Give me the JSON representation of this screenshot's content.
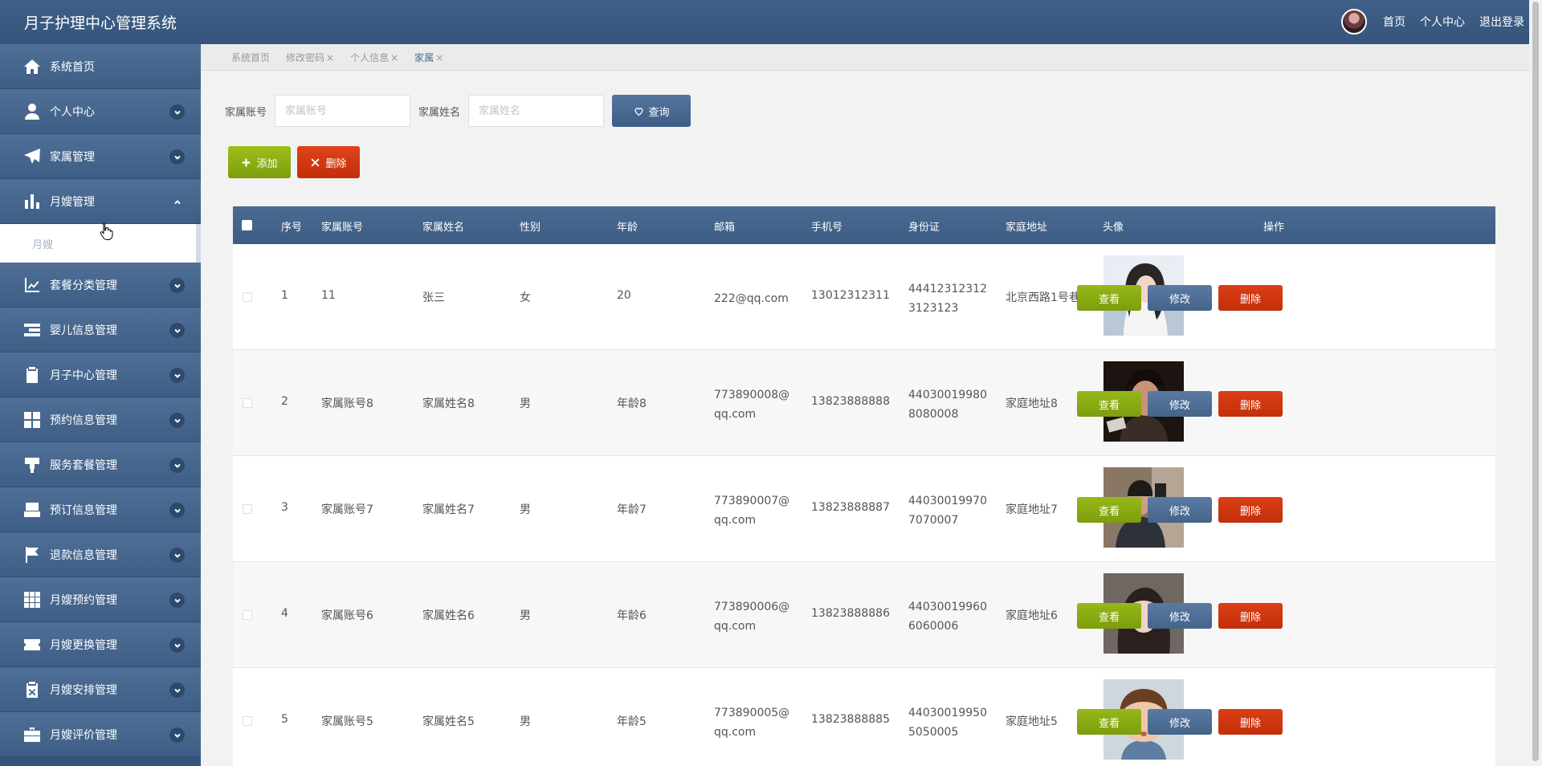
{
  "header": {
    "title": "月子护理中心管理系统",
    "links": [
      "首页",
      "个人中心",
      "退出登录"
    ]
  },
  "sidebar": {
    "items": [
      {
        "label": "系统首页",
        "icon": "home-icon"
      },
      {
        "label": "个人中心",
        "icon": "user-icon"
      },
      {
        "label": "家属管理",
        "icon": "paper-plane-icon"
      },
      {
        "label": "月嫂管理",
        "icon": "bar-chart-icon"
      },
      {
        "label": "套餐分类管理",
        "icon": "line-chart-icon"
      },
      {
        "label": "婴儿信息管理",
        "icon": "list-icon"
      },
      {
        "label": "月子中心管理",
        "icon": "clipboard-icon"
      },
      {
        "label": "预约信息管理",
        "icon": "grid-icon"
      },
      {
        "label": "服务套餐管理",
        "icon": "tag-icon"
      },
      {
        "label": "预订信息管理",
        "icon": "inbox-icon"
      },
      {
        "label": "退款信息管理",
        "icon": "flag-icon"
      },
      {
        "label": "月嫂预约管理",
        "icon": "apps-icon"
      },
      {
        "label": "月嫂更换管理",
        "icon": "ticket-icon"
      },
      {
        "label": "月嫂安排管理",
        "icon": "clipboard-x-icon"
      },
      {
        "label": "月嫂评价管理",
        "icon": "briefcase-icon"
      }
    ],
    "submenu": "月嫂"
  },
  "tabs": [
    {
      "label": "系统首页",
      "closable": false
    },
    {
      "label": "修改密码",
      "closable": true
    },
    {
      "label": "个人信息",
      "closable": true
    },
    {
      "label": "家属",
      "closable": true
    }
  ],
  "tab_close": "×",
  "search": {
    "account_label": "家属账号",
    "account_placeholder": "家属账号",
    "name_label": "家属姓名",
    "name_placeholder": "家属姓名",
    "query_button": "查询"
  },
  "toolbar": {
    "add": "添加",
    "delete": "删除"
  },
  "table": {
    "headers": [
      "序号",
      "家属账号",
      "家属姓名",
      "性别",
      "年龄",
      "邮箱",
      "手机号",
      "身份证",
      "家庭地址",
      "头像",
      "操作"
    ],
    "rows": [
      {
        "no": "1",
        "account": "11",
        "name": "张三",
        "gender": "女",
        "age": "20",
        "email": "222@qq.com",
        "phone": "13012312311",
        "idcard": "444123123123123123",
        "address": "北京西路1号巷"
      },
      {
        "no": "2",
        "account": "家属账号8",
        "name": "家属姓名8",
        "gender": "男",
        "age": "年龄8",
        "email": "773890008@qq.com",
        "phone": "13823888888",
        "idcard": "440300199808080008",
        "address": "家庭地址8"
      },
      {
        "no": "3",
        "account": "家属账号7",
        "name": "家属姓名7",
        "gender": "男",
        "age": "年龄7",
        "email": "773890007@qq.com",
        "phone": "13823888887",
        "idcard": "440300199707070007",
        "address": "家庭地址7"
      },
      {
        "no": "4",
        "account": "家属账号6",
        "name": "家属姓名6",
        "gender": "男",
        "age": "年龄6",
        "email": "773890006@qq.com",
        "phone": "13823888886",
        "idcard": "440300199606060006",
        "address": "家庭地址6"
      },
      {
        "no": "5",
        "account": "家属账号5",
        "name": "家属姓名5",
        "gender": "男",
        "age": "年龄5",
        "email": "773890005@qq.com",
        "phone": "13823888885",
        "idcard": "440300199505050005",
        "address": "家庭地址5"
      }
    ],
    "actions": {
      "view": "查看",
      "edit": "修改",
      "remove": "删除"
    }
  }
}
